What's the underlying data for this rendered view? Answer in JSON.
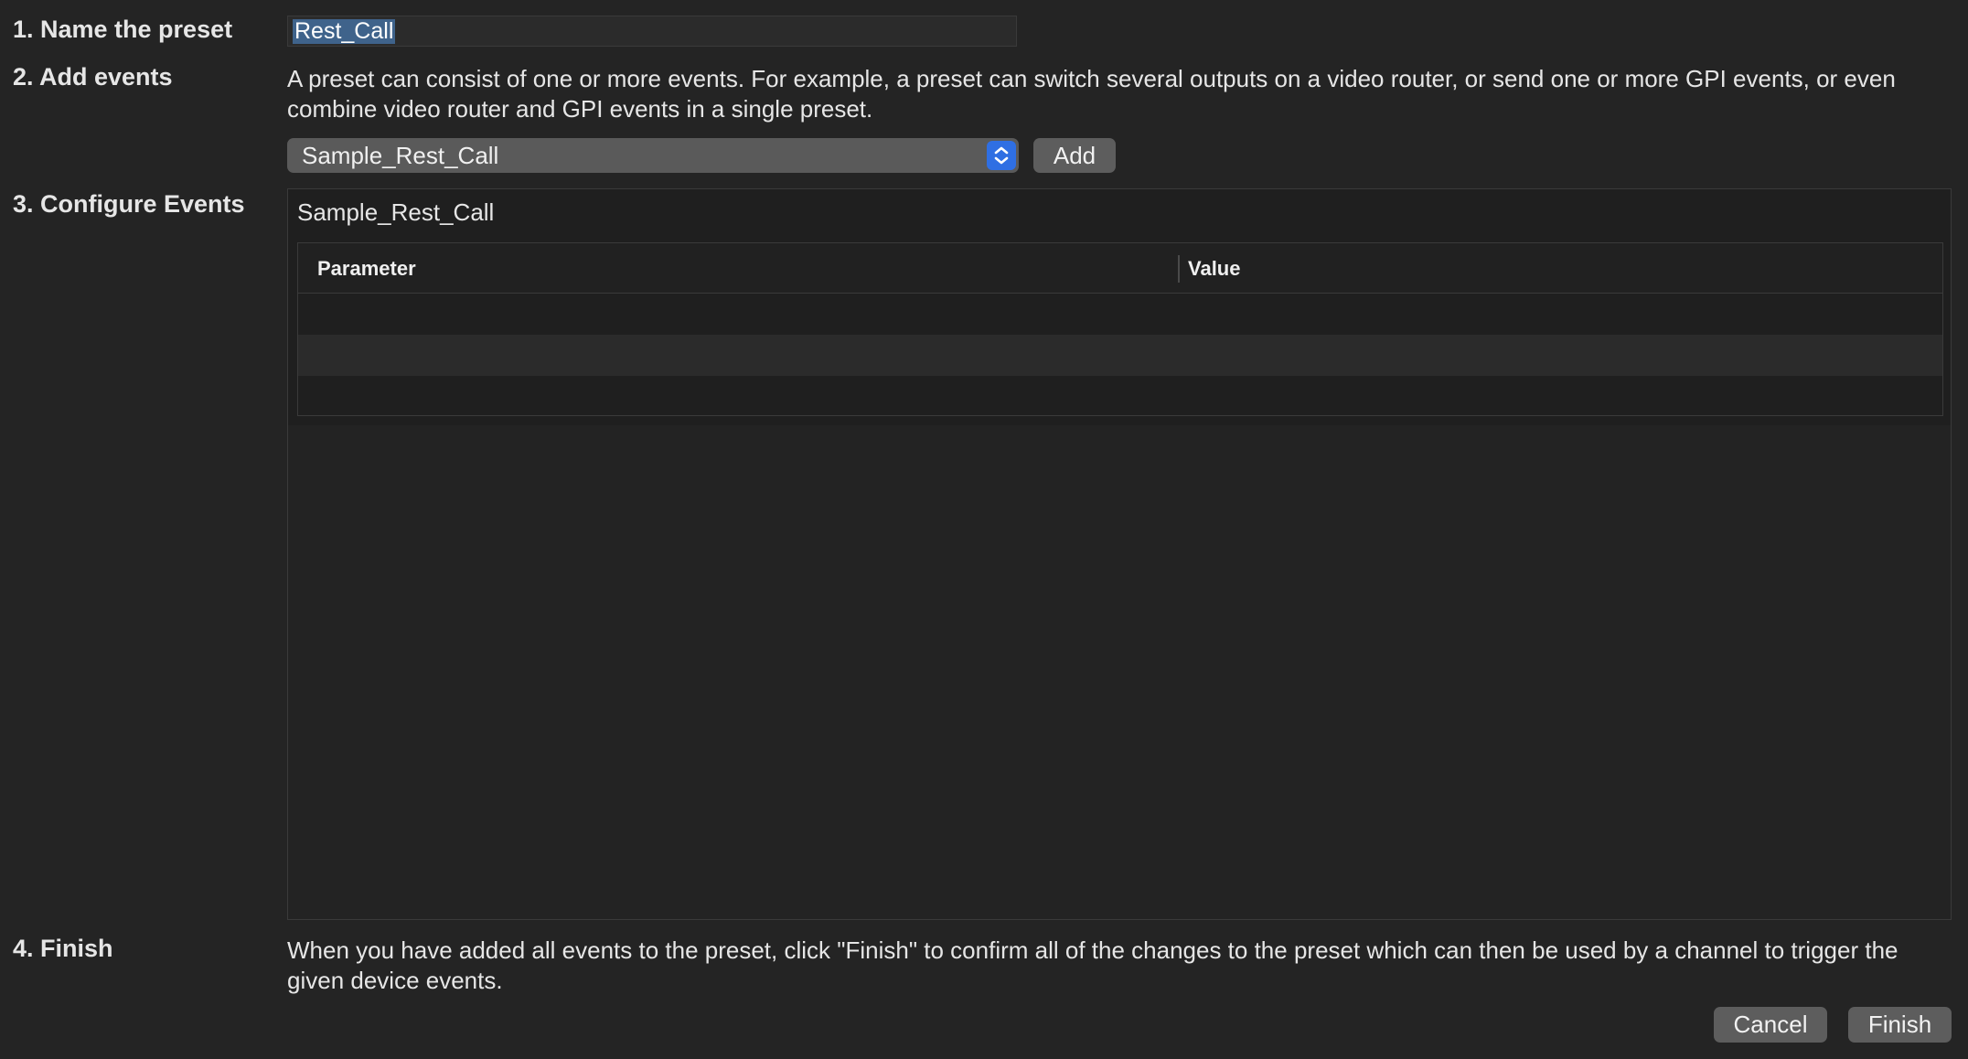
{
  "steps": {
    "name_label": "1. Name the preset",
    "add_label": "2. Add events",
    "configure_label": "3. Configure Events",
    "finish_label": "4. Finish"
  },
  "name_field": {
    "value": "Rest_Call"
  },
  "add_events": {
    "description": "A preset can consist of one or more events. For example, a preset can switch several outputs on a video router, or send one or more GPI events, or even combine video router and GPI events in a single preset.",
    "selected_event": "Sample_Rest_Call",
    "add_button": "Add"
  },
  "configure": {
    "event_title": "Sample_Rest_Call",
    "columns": [
      "Parameter",
      "Value"
    ],
    "rows": [
      {
        "parameter": "",
        "value": ""
      },
      {
        "parameter": "",
        "value": ""
      },
      {
        "parameter": "",
        "value": ""
      }
    ]
  },
  "finish": {
    "description": "When you have added all events to the preset, click \"Finish\" to confirm all of the changes to the preset which can then be used by a channel to trigger the given device events.",
    "cancel_button": "Cancel",
    "finish_button": "Finish"
  },
  "colors": {
    "background": "#242424",
    "selection": "#3f638b",
    "accent": "#2f6fe3",
    "button": "#5d5d5d"
  },
  "icons": {
    "stepper": "up-down-chevron-icon"
  }
}
